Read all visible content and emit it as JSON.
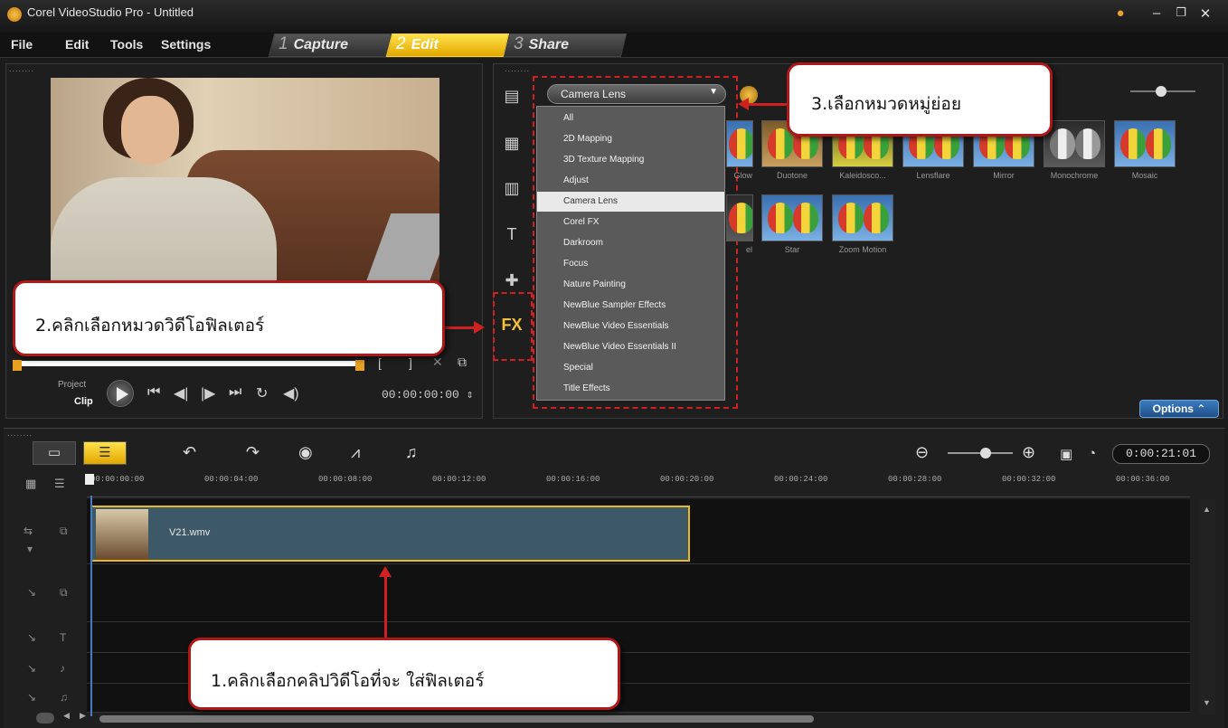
{
  "window": {
    "title": "Corel VideoStudio Pro - Untitled"
  },
  "menu": {
    "file": "File",
    "edit": "Edit",
    "tools": "Tools",
    "settings": "Settings"
  },
  "steps": [
    {
      "number": "1",
      "label": "Capture"
    },
    {
      "number": "2",
      "label": "Edit"
    },
    {
      "number": "3",
      "label": "Share"
    }
  ],
  "preview": {
    "project_label": "Project",
    "clip_label": "Clip",
    "timecode": "00:00:00:00",
    "mark_in": "[",
    "mark_out": "]"
  },
  "library": {
    "selected_category": "Camera Lens",
    "categories": [
      "All",
      "2D Mapping",
      "3D Texture Mapping",
      "Adjust",
      "Camera Lens",
      "Corel FX",
      "Darkroom",
      "Focus",
      "Nature Painting",
      "NewBlue Sampler Effects",
      "NewBlue Video Essentials",
      "NewBlue Video Essentials II",
      "Special",
      "Title Effects"
    ],
    "row1_filters": [
      "Glow",
      "Duotone",
      "Kaleidosco...",
      "Lensflare",
      "Mirror",
      "Monochrome",
      "Mosaic"
    ],
    "row2_filters": [
      "Star",
      "Zoom Motion"
    ],
    "row2_partial_label": "el",
    "fx_tab_label": "FX",
    "options_label": "Options"
  },
  "timeline": {
    "project_timecode": "0:00:21:01",
    "ruler": [
      "00:00:00:00",
      "00:00:04:00",
      "00:00:08:00",
      "00:00:12:00",
      "00:00:16:00",
      "00:00:20:00",
      "00:00:24:00",
      "00:00:28:00",
      "00:00:32:00",
      "00:00:36:00"
    ],
    "clip_name": "V21.wmv"
  },
  "callouts": {
    "step1": "1.คลิกเลือกคลิปวิดีโอที่จะ ใส่ฟิลเตอร์",
    "step2": "2.คลิกเลือกหมวดวิดีโอฟิลเตอร์",
    "step3": "3.เลือกหมวดหมู่ย่อย"
  },
  "colors": {
    "accent": "#f3c23a",
    "callout_border": "#b01818",
    "clip": "#3d5866",
    "options": "#2a68aa"
  }
}
